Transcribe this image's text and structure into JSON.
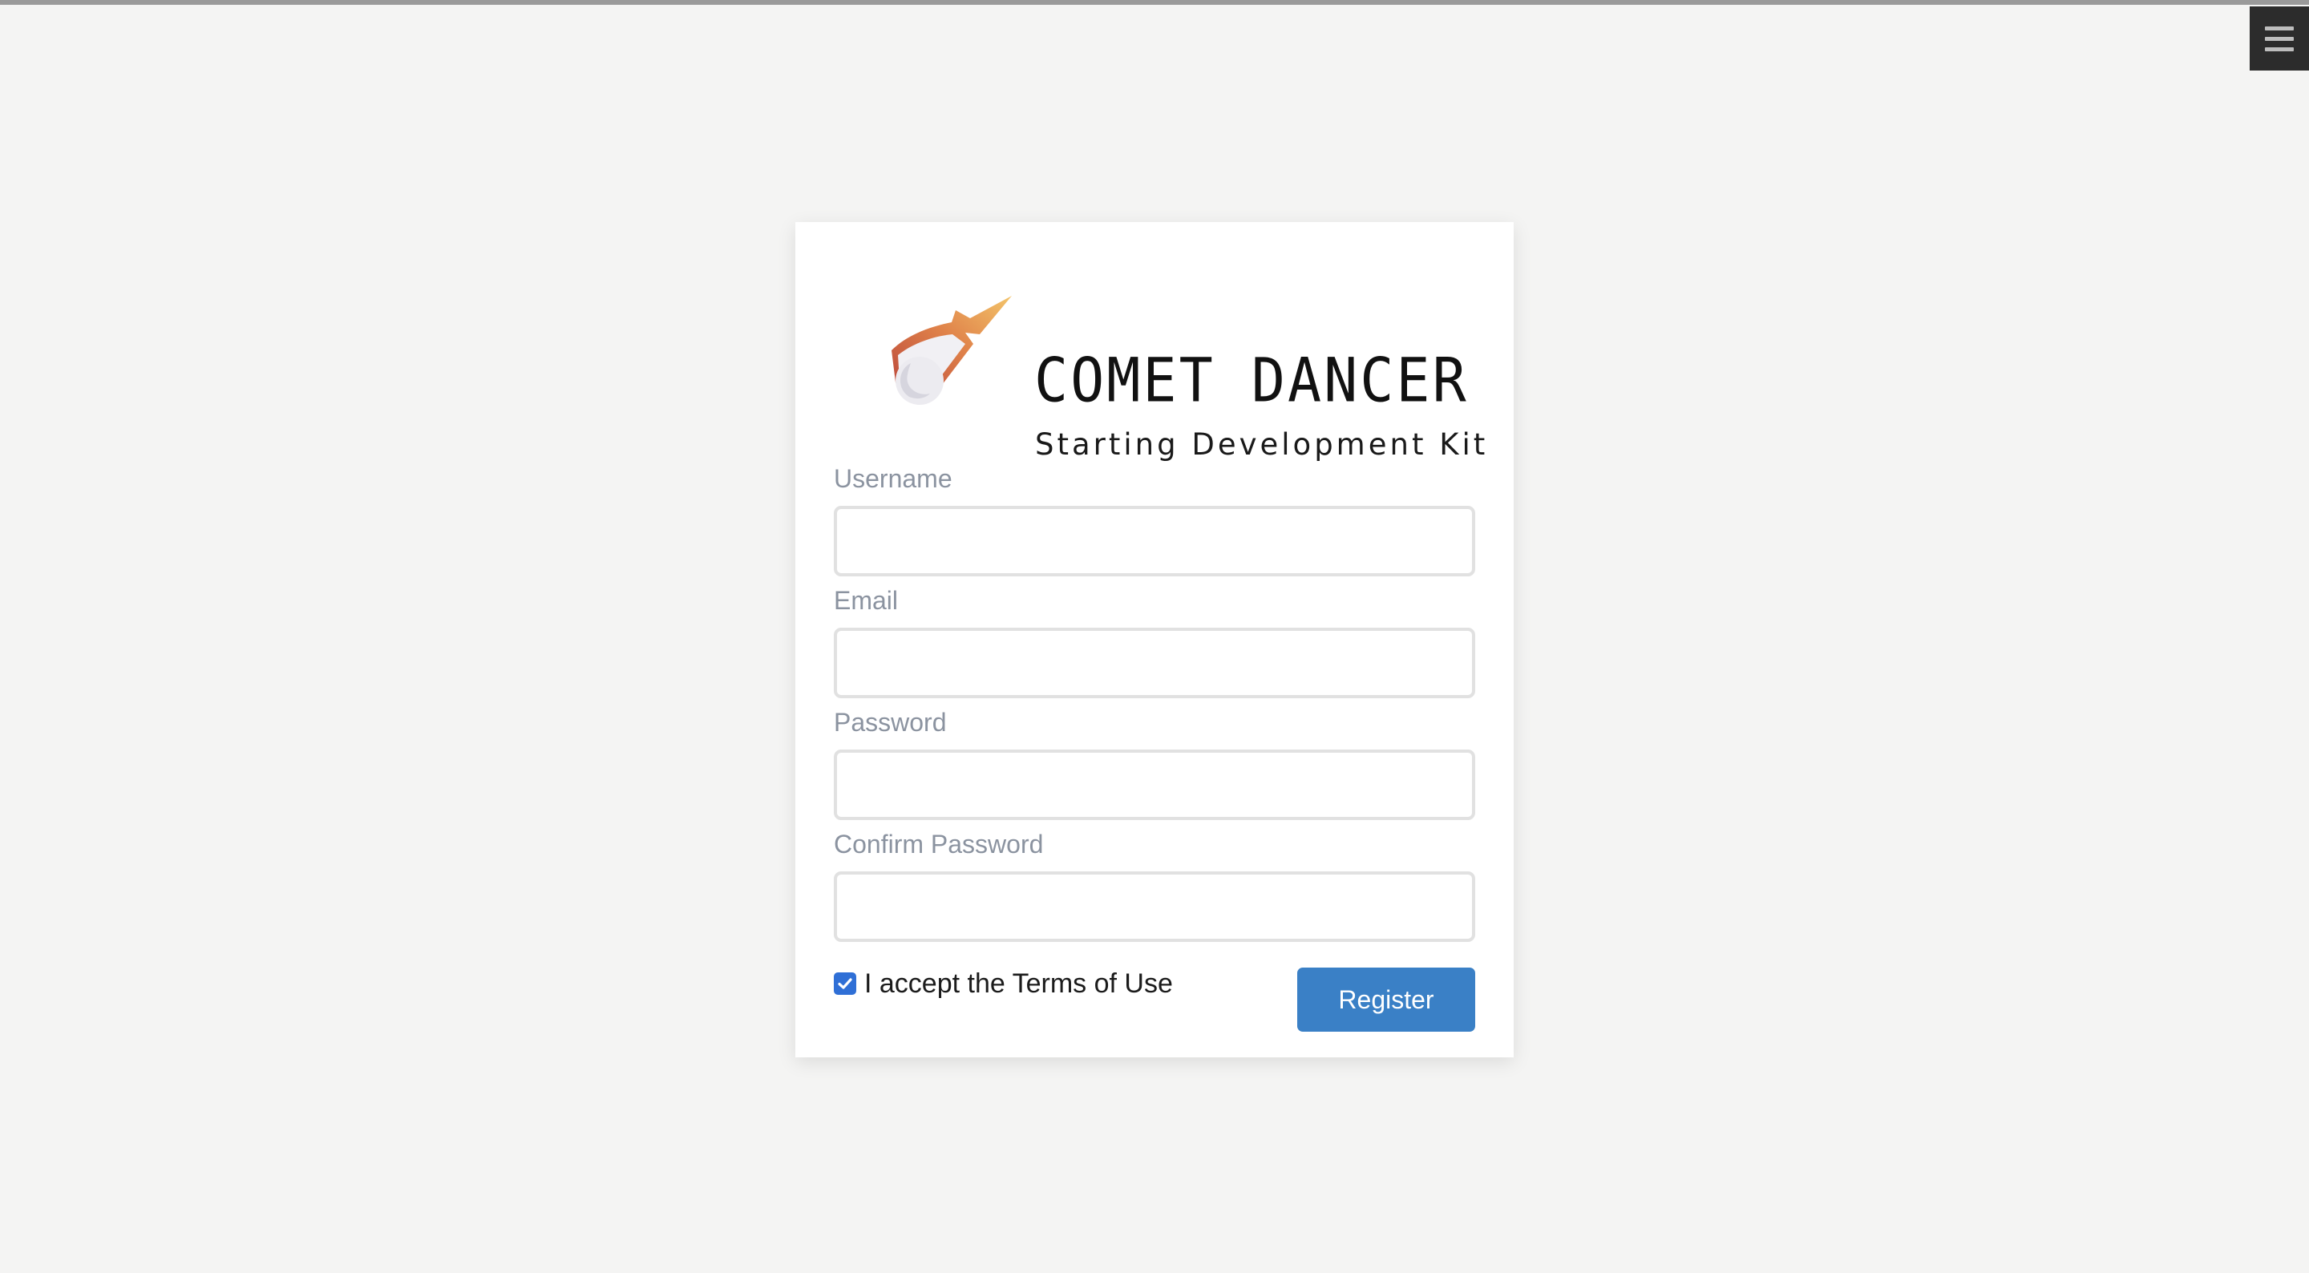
{
  "menu": {
    "icon": "hamburger-menu-icon"
  },
  "brand": {
    "logo_icon": "comet-logo-icon",
    "title": "COMET DANCER",
    "subtitle": "Starting Development Kit"
  },
  "form": {
    "username": {
      "label": "Username",
      "value": ""
    },
    "email": {
      "label": "Email",
      "value": ""
    },
    "password": {
      "label": "Password",
      "value": ""
    },
    "confirm_password": {
      "label": "Confirm Password",
      "value": ""
    },
    "terms": {
      "label": "I accept the Terms of Use",
      "checked": true
    },
    "register_label": "Register"
  },
  "colors": {
    "background": "#f4f4f3",
    "card": "#ffffff",
    "button": "#3a80c6",
    "checkbox": "#2f6fd6",
    "label": "#8b93a0",
    "logo_orange": "#e8a45a",
    "logo_red": "#c0523a"
  }
}
